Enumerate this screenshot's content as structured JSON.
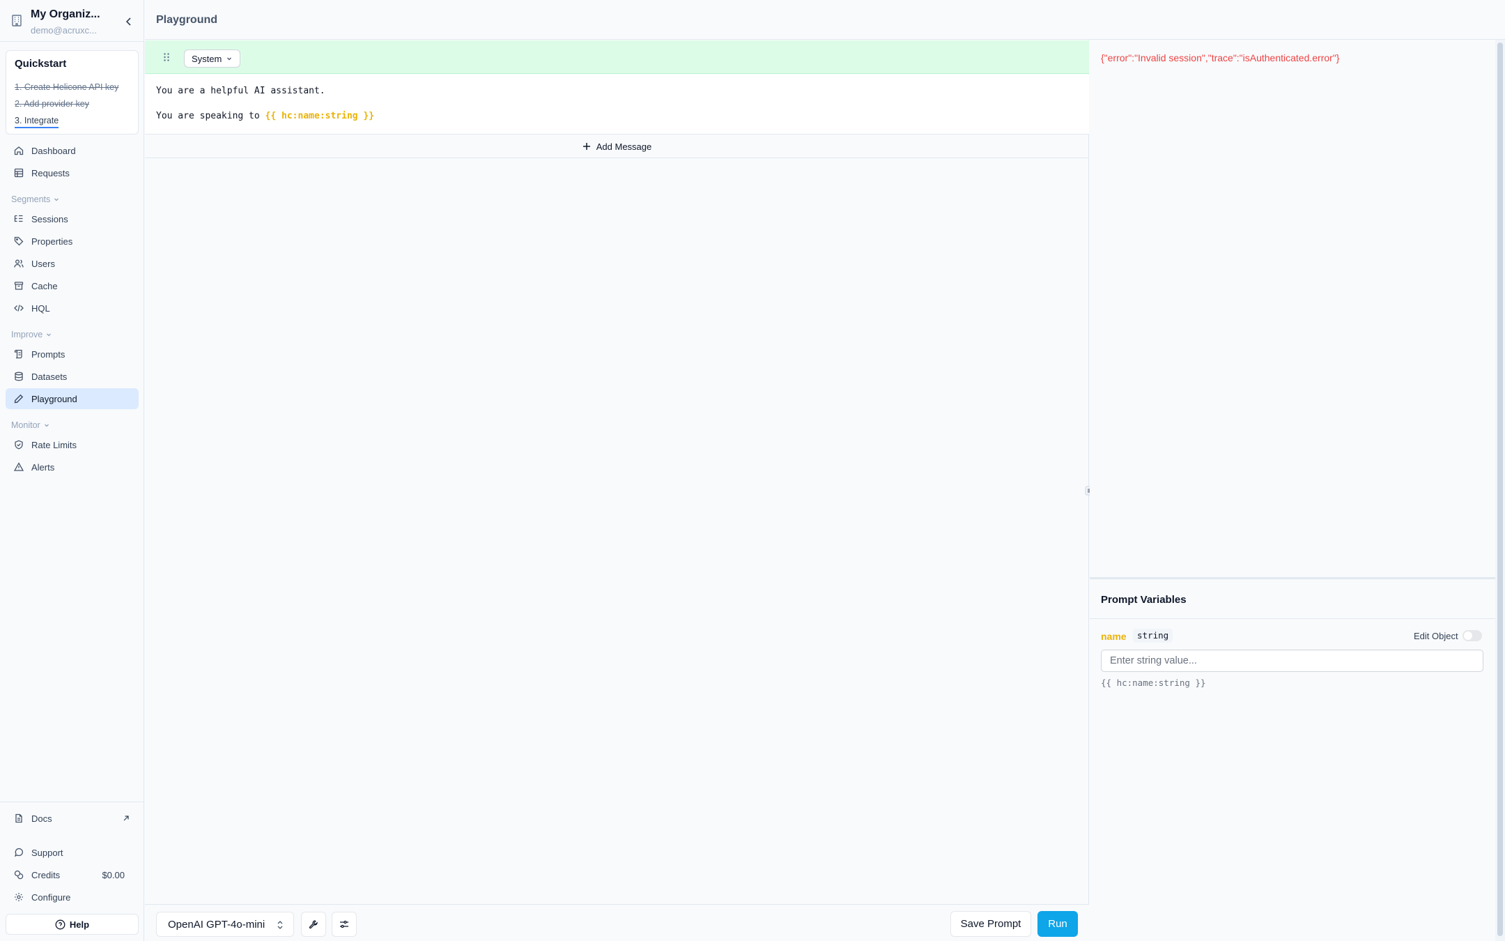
{
  "org": {
    "name": "My Organiz...",
    "email": "demo@acruxc..."
  },
  "quickstart": {
    "title": "Quickstart",
    "steps": [
      "1. Create Helicone API key",
      "2. Add provider key",
      "3. Integrate"
    ]
  },
  "nav": {
    "dashboard": "Dashboard",
    "requests": "Requests",
    "segments": "Segments",
    "sessions": "Sessions",
    "properties": "Properties",
    "users": "Users",
    "cache": "Cache",
    "hql": "HQL",
    "improve": "Improve",
    "prompts": "Prompts",
    "datasets": "Datasets",
    "playground": "Playground",
    "monitor": "Monitor",
    "rate_limits": "Rate Limits",
    "alerts": "Alerts"
  },
  "bottom_nav": {
    "docs": "Docs",
    "support": "Support",
    "credits": "Credits",
    "credits_value": "$0.00",
    "configure": "Configure",
    "help": "Help"
  },
  "header": {
    "title": "Playground"
  },
  "message": {
    "role": "System",
    "line1": "You are a helpful AI assistant.",
    "line2_prefix": "You are speaking to ",
    "line2_variable": "{{ hc:name:string }}"
  },
  "add_message": "Add Message",
  "toolbar": {
    "model": "OpenAI GPT-4o-mini",
    "save": "Save Prompt",
    "run": "Run"
  },
  "response": {
    "error": "{\"error\":\"Invalid session\",\"trace\":\"isAuthenticated.error\"}"
  },
  "variables": {
    "title": "Prompt Variables",
    "items": [
      {
        "name": "name",
        "type": "string",
        "edit_label": "Edit Object",
        "edit_enabled": false,
        "placeholder": "Enter string value...",
        "template": "{{ hc:name:string }}"
      }
    ]
  },
  "colors": {
    "accent": "#0ea5e9",
    "active_nav": "#dbeafe",
    "system_bar": "#dcfce7",
    "variable": "#eab308",
    "error": "#ef4444"
  }
}
